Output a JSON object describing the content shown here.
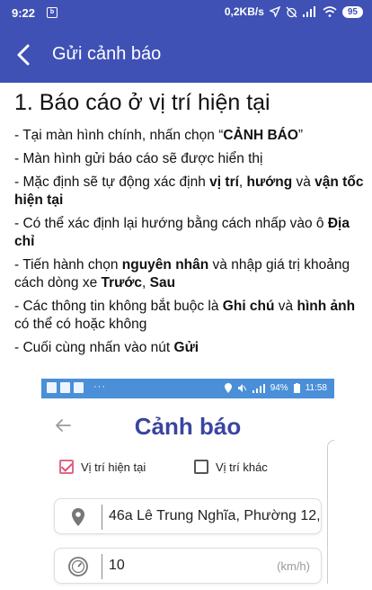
{
  "status_bar": {
    "time": "9:22",
    "notification_glyph": "b",
    "net_speed": "0,2KB/s",
    "battery": "95"
  },
  "app_bar": {
    "title": "Gửi cảnh báo"
  },
  "content": {
    "heading": "1. Báo cáo ở vị trí hiện tại",
    "steps": [
      [
        "- Tại màn hình chính, nhấn chọn “",
        "CẢNH BÁO",
        "”"
      ],
      [
        "- Màn hình gửi báo cáo sẽ được hiển thị"
      ],
      [
        "- Mặc định sẽ tự động xác định ",
        "vị trí",
        ", ",
        "hướng",
        " và ",
        "vận tốc hiện tại"
      ],
      [
        "- Có thể xác định lại hướng bằng cách nhấp vào ô ",
        "Địa chỉ"
      ],
      [
        "- Tiến hành chọn ",
        "nguyên nhân",
        " và nhập giá trị khoảng cách dòng xe ",
        "Trước",
        ", ",
        "Sau"
      ],
      [
        "- Các thông tin không bắt buộc là ",
        "Ghi chú",
        " và ",
        "hình ảnh",
        " có thể có hoặc không"
      ],
      [
        "- Cuối cùng nhấn vào nút ",
        "Gửi"
      ]
    ]
  },
  "embedded_screen": {
    "status_bar": {
      "dots": "···",
      "battery": "94%",
      "time": "11:58"
    },
    "title": "Cảnh báo",
    "current_location_label": "Vị trí hiện tại",
    "current_location_checked": true,
    "other_location_label": "Vị trí khác",
    "other_location_checked": false,
    "address_value": "46a Lê Trung Nghĩa, Phường 12,",
    "speed_value": "10",
    "speed_unit": "(km/h)",
    "colors": {
      "status_bar": "#4a8fd8",
      "title": "#3a45a0",
      "checkbox_accent": "#e0527a"
    }
  },
  "colors": {
    "primary": "#3f51b5"
  }
}
